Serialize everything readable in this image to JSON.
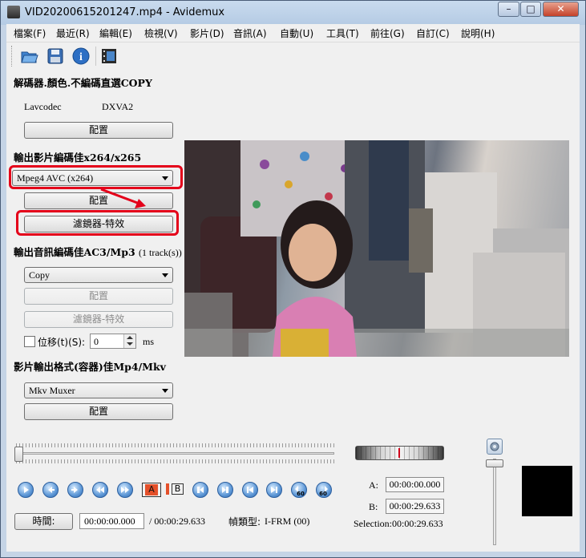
{
  "window": {
    "title": "VID20200615201247.mp4 - Avidemux",
    "minimize": "–",
    "maximize": "□",
    "close": "✕"
  },
  "menu": [
    "檔案(F)",
    "最近(R)",
    "編輯(E)",
    "檢視(V)",
    "影片(D)",
    "音訊(A)",
    "自動(U)",
    "工具(T)",
    "前往(G)",
    "自訂(C)",
    "說明(H)"
  ],
  "toolbar": {
    "icons": [
      "open-folder-icon",
      "save-floppy-icon",
      "info-icon",
      "film-properties-icon"
    ],
    "info_glyph": "i"
  },
  "decoder": {
    "title": "解碼器.顏色.不編碼直選COPY",
    "codec": "Lavcodec",
    "hw": "DXVA2",
    "config_label": "配置"
  },
  "video_output": {
    "title": "輸出影片編碼佳x264/x265",
    "selected": "Mpeg4 AVC (x264)",
    "config_label": "配置",
    "filters_label": "濾鏡器-特效"
  },
  "audio_output": {
    "title": "輸出音訊編碼佳AC3/Mp3",
    "tracks": "(1 track(s))",
    "selected": "Copy",
    "config_label": "配置",
    "filters_label": "濾鏡器-特效",
    "shift_label": "位移(t)(S):",
    "shift_value": "0",
    "shift_unit": "ms"
  },
  "muxer": {
    "title": "影片輸出格式(容器)佳Mp4/Mkv",
    "selected": "Mkv Muxer",
    "config_label": "配置"
  },
  "transport": {
    "ab_a": "A",
    "ab_b": "B",
    "jump_glyph": "60"
  },
  "markers": {
    "a_label": "A:",
    "a_value": "00:00:00.000",
    "b_label": "B:",
    "b_value": "00:00:29.633",
    "selection_label": "Selection:",
    "selection_value": "00:00:29.633"
  },
  "status": {
    "time_button": "時間:",
    "current_time": "00:00:00.000",
    "total_time": "/ 00:00:29.633",
    "frame_type_label": "幀類型:",
    "frame_type_value": "I-FRM (00)"
  },
  "colors": {
    "annotation_red": "#e4001a",
    "titlebar": "#c5d4e6",
    "playback_blue": "#3a78c2"
  }
}
